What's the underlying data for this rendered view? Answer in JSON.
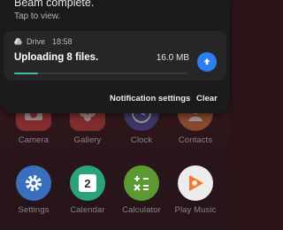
{
  "notifications": {
    "beam": {
      "title": "Beam complete.",
      "subtitle": "Tap to view."
    },
    "drive": {
      "app": "Drive",
      "time": "18:58",
      "title": "Uploading 8 files.",
      "size": "16.0 MB",
      "progress": 0.14,
      "action_icon": "upload-arrow-icon"
    },
    "actions": {
      "settings": "Notification settings",
      "clear": "Clear"
    }
  },
  "home_apps": [
    {
      "label": "Camera",
      "color": "#c94040",
      "icon": "camera-icon"
    },
    {
      "label": "Gallery",
      "color": "#c2403e",
      "icon": "gallery-flower-icon"
    },
    {
      "label": "Clock",
      "color": "#4a52a8",
      "icon": "clock-icon"
    },
    {
      "label": "Contacts",
      "color": "#d0703a",
      "icon": "contacts-icon"
    },
    {
      "label": "Settings",
      "color": "#3a6fbd",
      "icon": "gear-icon"
    },
    {
      "label": "Calendar",
      "color": "#2aa37a",
      "icon": "calendar-icon",
      "day": "2"
    },
    {
      "label": "Calculator",
      "color": "#5b9a32",
      "icon": "calculator-icon"
    },
    {
      "label": "Play Music",
      "color": "#ececec",
      "icon": "play-music-icon"
    }
  ],
  "colors": {
    "shade": "#1b1b1d",
    "card": "#262628",
    "accent_button": "#2f7ef0",
    "progress": "#3dbfa6"
  }
}
